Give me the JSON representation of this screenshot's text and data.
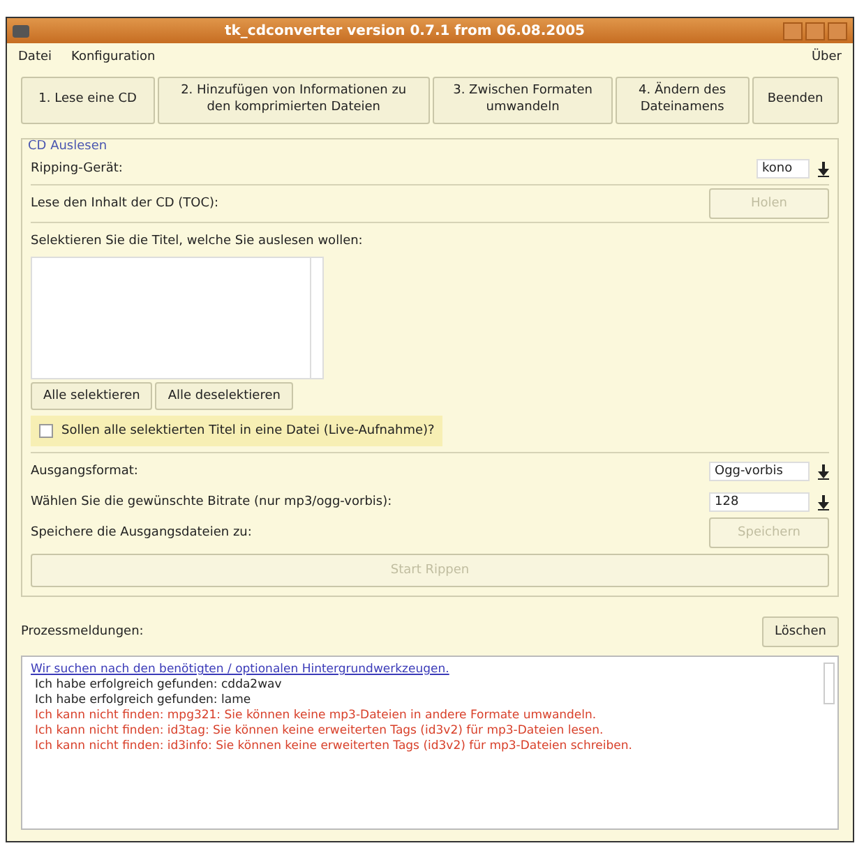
{
  "window": {
    "title": "tk_cdconverter version 0.7.1 from 06.08.2005"
  },
  "menu": [
    {
      "label": "Datei"
    },
    {
      "label": "Konfiguration"
    }
  ],
  "menu_right": {
    "label": "Über"
  },
  "steps": [
    {
      "label": "1. Lese eine CD"
    },
    {
      "label": "2. Hinzufügen von Informationen zu den komprimierten Dateien"
    },
    {
      "label": "3. Zwischen Formaten umwandeln"
    },
    {
      "label": "4. Ändern des Dateinamens"
    },
    {
      "label": "Beenden"
    }
  ],
  "group": {
    "title": "CD Auslesen",
    "device": {
      "label": "Ripping-Gerät:",
      "value": "kono"
    },
    "toc": {
      "label": "Lese den Inhalt der CD (TOC):",
      "button": "Holen",
      "disabled": true
    },
    "select_label": "Selektieren Sie die Titel, welche Sie auslesen wollen:",
    "select_buttons": [
      "Alle selektieren",
      "Alle deselektieren"
    ],
    "live": {
      "label": "Sollen alle selektierten Titel in eine Datei (Live-Aufnahme)?",
      "checked": false
    },
    "format": {
      "label": "Ausgangsformat:",
      "value": "Ogg-vorbis"
    },
    "bitrate": {
      "label": "Wählen Sie die gewünschte Bitrate (nur mp3/ogg-vorbis):",
      "value": "128"
    },
    "save": {
      "label": "Speichere die Ausgangsdateien zu:",
      "button": "Speichern",
      "disabled": true
    },
    "start": {
      "button": "Start Rippen",
      "disabled": true
    }
  },
  "log": {
    "label": "Prozessmeldungen:",
    "clear_button": "Löschen",
    "lines": [
      {
        "kind": "link",
        "text": "Wir suchen nach den benötigten / optionalen Hintergrundwerkzeugen."
      },
      {
        "kind": "ok",
        "text": "Ich habe erfolgreich gefunden: cdda2wav"
      },
      {
        "kind": "ok",
        "text": "Ich habe erfolgreich gefunden: lame"
      },
      {
        "kind": "error",
        "text": "Ich kann nicht finden: mpg321: Sie können keine mp3-Dateien in andere Formate umwandeln."
      },
      {
        "kind": "error",
        "text": "Ich kann nicht finden: id3tag: Sie können keine erweiterten Tags (id3v2) für mp3-Dateien lesen."
      },
      {
        "kind": "error",
        "text": "Ich kann nicht finden: id3info: Sie können keine erweiterten Tags (id3v2) für mp3-Dateien schreiben."
      }
    ]
  }
}
